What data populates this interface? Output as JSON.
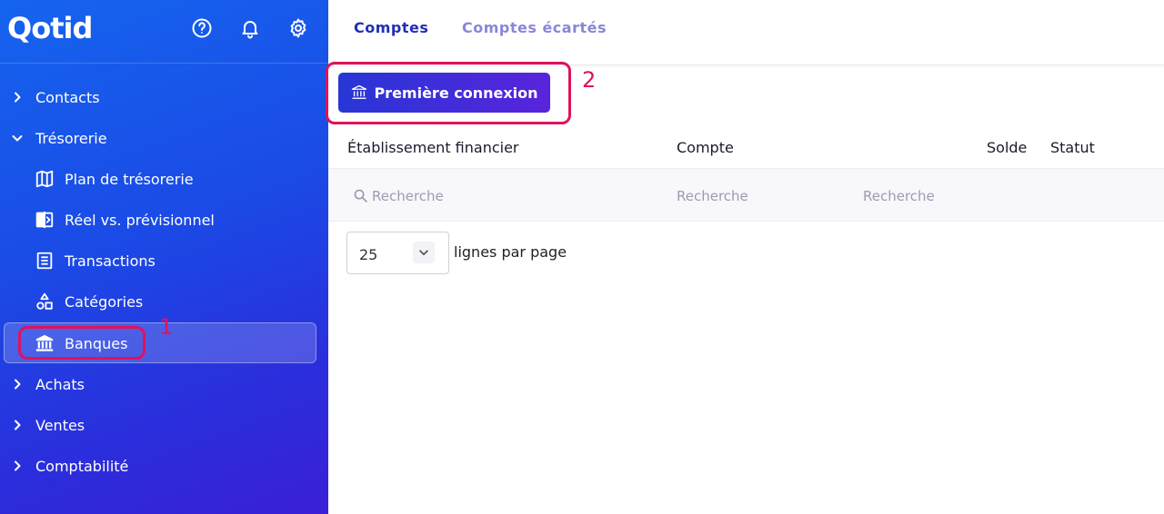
{
  "app": {
    "logo": "Qotid"
  },
  "sidebar": {
    "menu": [
      {
        "label": "Contacts",
        "expanded": false
      },
      {
        "label": "Trésorerie",
        "expanded": true
      },
      {
        "label": "Achats",
        "expanded": false
      },
      {
        "label": "Ventes",
        "expanded": false
      },
      {
        "label": "Comptabilité",
        "expanded": false
      }
    ],
    "tresorerie_items": [
      {
        "label": "Plan de trésorerie",
        "icon": "map-icon"
      },
      {
        "label": "Réel vs. prévisionnel",
        "icon": "compare-icon"
      },
      {
        "label": "Transactions",
        "icon": "list-icon"
      },
      {
        "label": "Catégories",
        "icon": "shapes-icon"
      },
      {
        "label": "Banques",
        "icon": "bank-icon",
        "active": true
      }
    ]
  },
  "header_icons": [
    "help-icon",
    "bell-icon",
    "gear-icon"
  ],
  "tabs": [
    {
      "label": "Comptes",
      "active": true
    },
    {
      "label": "Comptes écartés",
      "active": false
    }
  ],
  "toolbar": {
    "first_connection_label": "Première connexion"
  },
  "table": {
    "columns": [
      "Établissement financier",
      "Compte",
      "Solde",
      "Statut"
    ],
    "filter_placeholders": [
      "Recherche",
      "Recherche",
      "Recherche"
    ]
  },
  "pagination": {
    "rows_per_page": "25",
    "rows_per_page_label": "lignes par page"
  },
  "annotations": [
    "1",
    "2"
  ],
  "colors": {
    "sidebar_start": "#1564ee",
    "sidebar_end": "#3a1fd6",
    "accent": "#1f2fb8",
    "tab_inactive": "#8a86d8",
    "callout": "#e0125c"
  }
}
